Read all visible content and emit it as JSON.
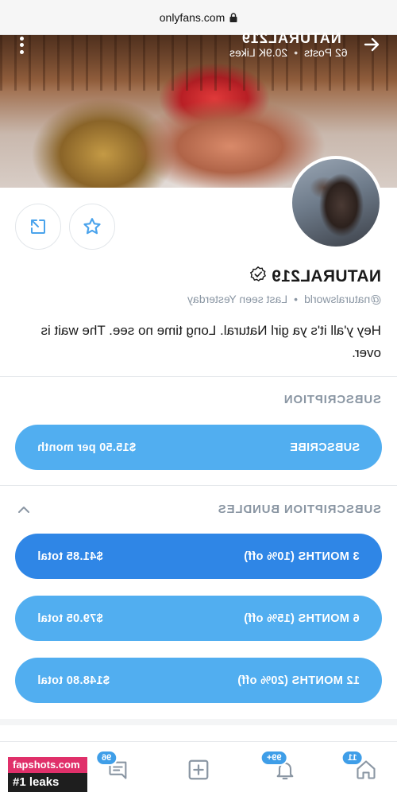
{
  "browser": {
    "url": "onlyfans.com",
    "lock_icon": "lock-icon"
  },
  "cover": {
    "name": "NATURAL219",
    "posts": "62 Posts",
    "likes": "20.9K Likes",
    "separator": "•"
  },
  "profile": {
    "name": "NATURAL219",
    "handle": "@naturalsworld",
    "last_seen": "Last seen Yesterday",
    "separator": "•",
    "bio": "Hey y'all it's ya girl Natural. Long time no see. The wait is over."
  },
  "subscription": {
    "title": "SUBSCRIPTION",
    "button_label": "SUBSCRIBE",
    "price": "$15.50 per month"
  },
  "bundles": {
    "title": "SUBSCRIPTION BUNDLES",
    "items": [
      {
        "label": "3 MONTHS (10% off)",
        "price": "$41.85 total"
      },
      {
        "label": "6 MONTHS (15% off)",
        "price": "$79.05 total"
      },
      {
        "label": "12 MONTHS (20% off)",
        "price": "$148.80 total"
      }
    ]
  },
  "nav": {
    "home_badge": "11",
    "notifications_badge": "99+",
    "messages_badge": "96"
  },
  "watermark": {
    "top": "fapshots.com",
    "bottom": "#1 leaks"
  },
  "colors": {
    "accent": "#51aef0",
    "accent_active": "#2f86e6",
    "muted": "#8a96a3"
  }
}
